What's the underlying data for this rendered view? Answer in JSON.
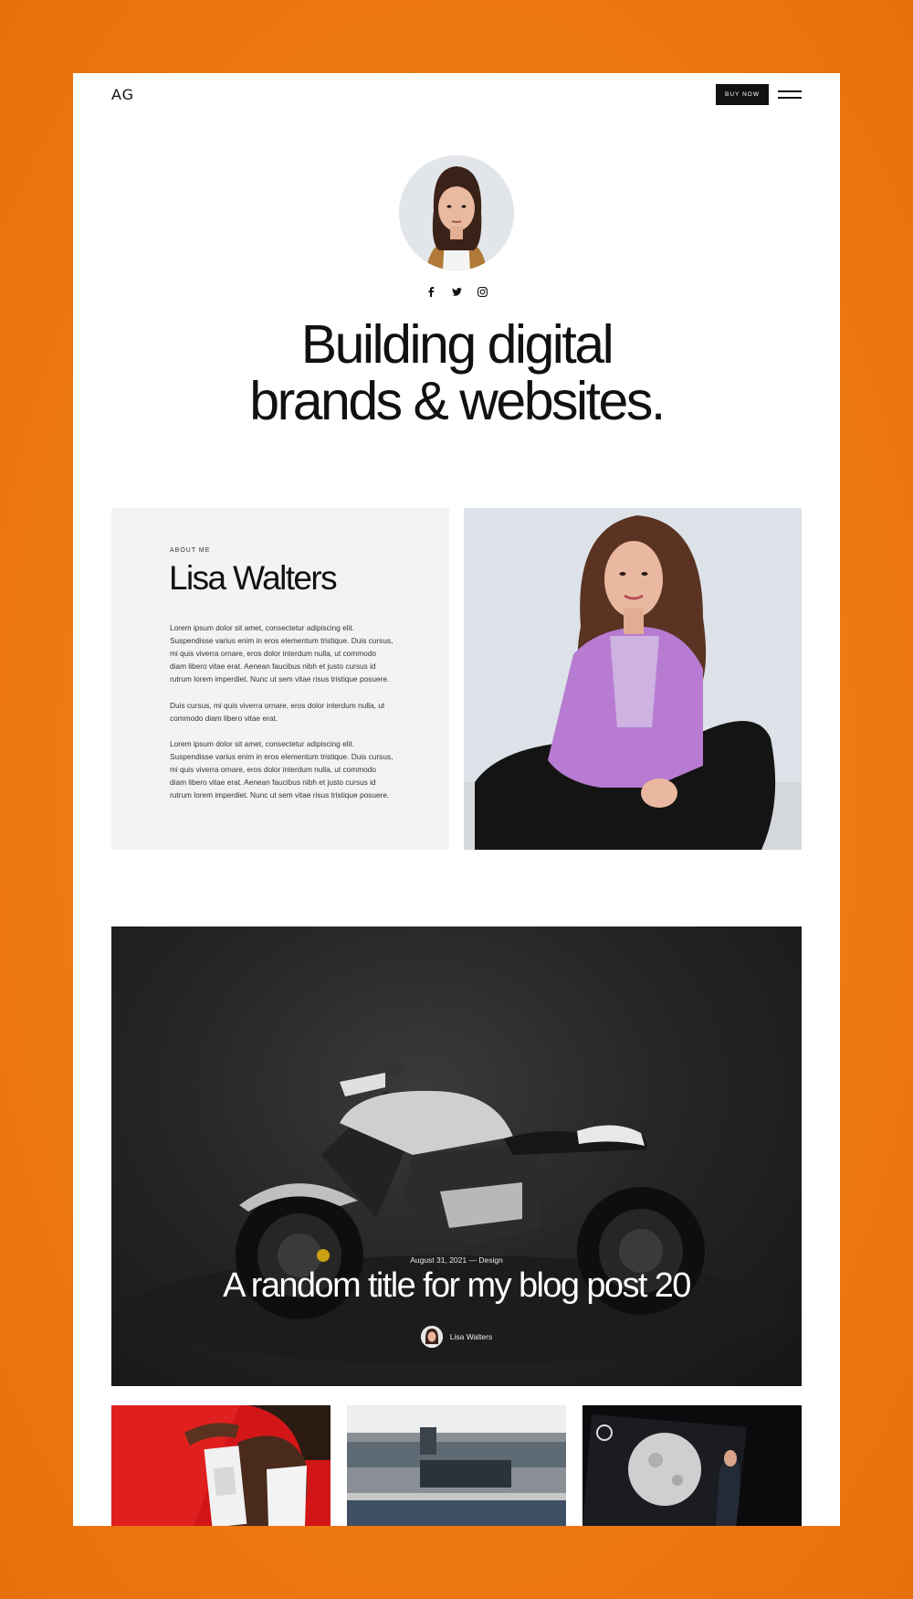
{
  "header": {
    "logo": "AG",
    "buy_button": "BUY NOW"
  },
  "hero": {
    "title_line1": "Building digital",
    "title_line2": "brands & websites.",
    "socials": [
      "facebook-icon",
      "twitter-icon",
      "instagram-icon"
    ]
  },
  "about": {
    "eyebrow": "ABOUT ME",
    "name": "Lisa Walters",
    "paragraphs": [
      "Lorem ipsum dolor sit amet, consectetur adipiscing elit. Suspendisse varius enim in eros elementum tristique. Duis cursus, mi quis viverra ornare, eros dolor interdum nulla, ut commodo diam libero vitae erat. Aenean faucibus nibh et justo cursus id rutrum lorem imperdiet. Nunc ut sem vitae risus tristique posuere.",
      "Duis cursus, mi quis viverra ornare, eros dolor interdum nulla, ut commodo diam libero vitae erat.",
      "Lorem ipsum dolor sit amet, consectetur adipiscing elit. Suspendisse varius enim in eros elementum tristique. Duis cursus, mi quis viverra ornare, eros dolor interdum nulla, ut commodo diam libero vitae erat. Aenean faucibus nibh et justo cursus id rutrum lorem imperdiet. Nunc ut sem vitae risus tristique posuere."
    ]
  },
  "featured_post": {
    "meta": "August 31, 2021 — Design",
    "title": "A random title for my blog post 20",
    "author": "Lisa Walters"
  },
  "colors": {
    "background": "#ee7b15",
    "accent": "#111111",
    "card": "#f1f3f5"
  }
}
